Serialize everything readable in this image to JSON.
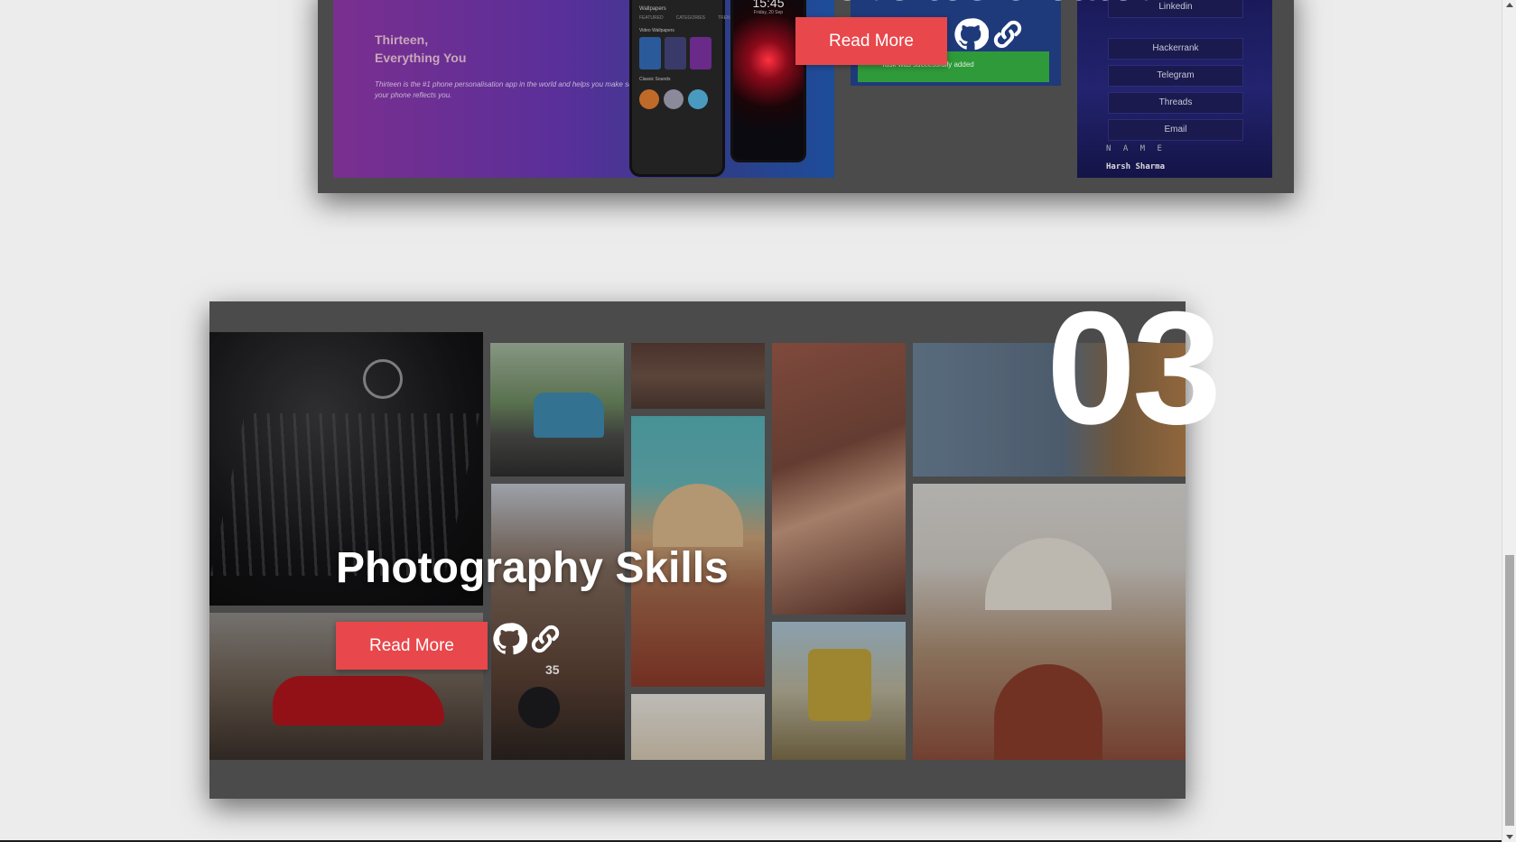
{
  "project2": {
    "title": "Websites created",
    "read_more": "Read More",
    "app_preview": {
      "title_line1": "Thirteen,",
      "title_line2": "Everything You",
      "description": "Thirteen is the #1 phone personalisation app in the world and helps you make sure your phone reflects you.",
      "phone_header": "Wallpapers",
      "phone_tabs": [
        "FEATURED",
        "CATEGORIES",
        "TRENDING"
      ],
      "section_video": "Video Wallpapers",
      "section_classic": "Classic Sounds",
      "lock_time": "15:45",
      "lock_date": "Friday, 20 Sep"
    },
    "task_preview": {
      "toast": "Task was successfully added"
    },
    "links_preview": {
      "links": [
        "Linkedin",
        "Hackerrank",
        "Telegram",
        "Threads",
        "Email"
      ],
      "name_label": "N A M E",
      "name_value": "Harsh Sharma"
    }
  },
  "project3": {
    "number": "03",
    "title": "Photography Skills",
    "read_more": "Read More",
    "photo_numbers": {
      "building_number": "35"
    }
  },
  "icons": {
    "github": "github-icon",
    "link": "link-icon"
  },
  "colors": {
    "accent": "#e8474b",
    "card": "#4b4b4b",
    "page_bg": "#ececec"
  }
}
